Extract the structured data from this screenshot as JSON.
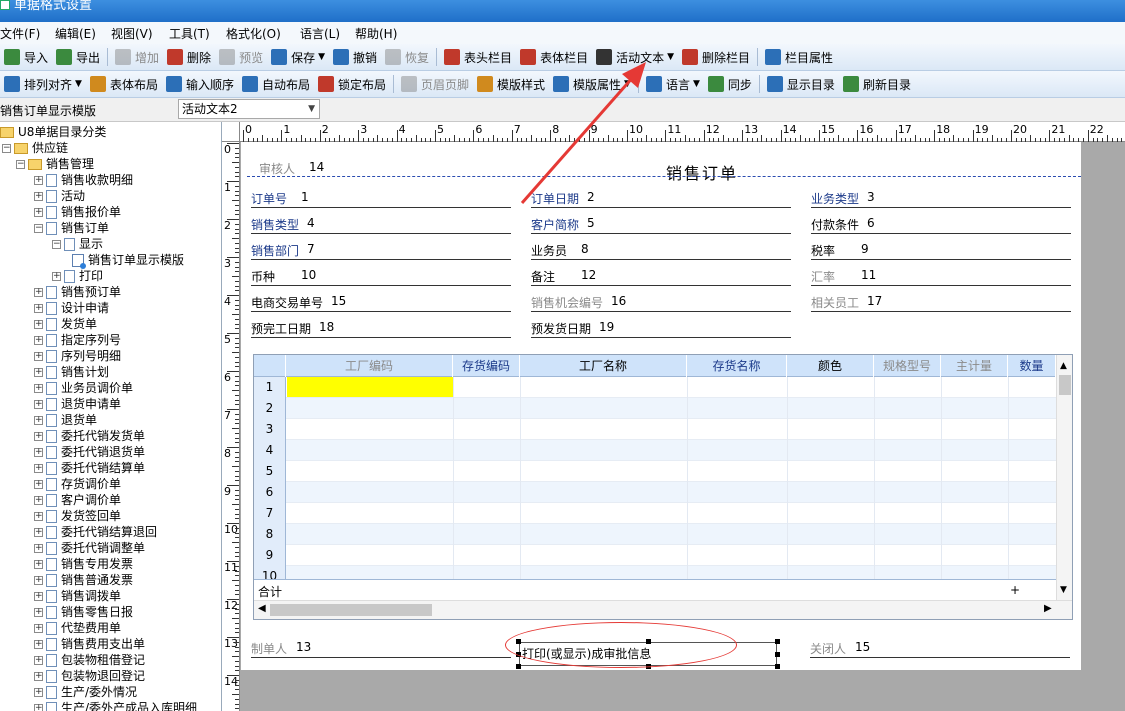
{
  "window": {
    "title": "单据格式设置"
  },
  "menu": [
    "文件(F)",
    "编辑(E)",
    "视图(V)",
    "工具(T)",
    "格式化(O)",
    "语言(L)",
    "帮助(H)"
  ],
  "toolbar1": [
    {
      "label": "导入",
      "icon": "import-icon",
      "color": "#3b8a3e",
      "enabled": true
    },
    {
      "label": "导出",
      "icon": "export-icon",
      "color": "#3b8a3e",
      "enabled": true
    },
    {
      "label": "增加",
      "icon": "add-icon",
      "color": "#7f7f7f",
      "enabled": false
    },
    {
      "label": "删除",
      "icon": "delete-icon",
      "color": "#c0392b",
      "enabled": true
    },
    {
      "label": "预览",
      "icon": "preview-icon",
      "color": "#7f7f7f",
      "enabled": false
    },
    {
      "label": "保存",
      "icon": "save-icon",
      "color": "#2c6fb7",
      "enabled": true,
      "dropdown": true
    },
    {
      "label": "撤销",
      "icon": "undo-icon",
      "color": "#2c6fb7",
      "enabled": true
    },
    {
      "label": "恢复",
      "icon": "redo-icon",
      "color": "#7f7f7f",
      "enabled": false
    },
    {
      "label": "表头栏目",
      "icon": "header-columns-icon",
      "color": "#c0392b",
      "enabled": true
    },
    {
      "label": "表体栏目",
      "icon": "body-columns-icon",
      "color": "#c0392b",
      "enabled": true
    },
    {
      "label": "活动文本",
      "icon": "active-text-icon",
      "color": "#333333",
      "enabled": true,
      "dropdown": true
    },
    {
      "label": "删除栏目",
      "icon": "delete-column-icon",
      "color": "#c0392b",
      "enabled": true
    },
    {
      "label": "栏目属性",
      "icon": "column-properties-icon",
      "color": "#2c6fb7",
      "enabled": true
    }
  ],
  "toolbar2": [
    {
      "label": "排列对齐",
      "icon": "align-icon",
      "color": "#2c6fb7",
      "enabled": true,
      "dropdown": true
    },
    {
      "label": "表体布局",
      "icon": "body-layout-icon",
      "color": "#d08a1e",
      "enabled": true
    },
    {
      "label": "输入顺序",
      "icon": "input-order-icon",
      "color": "#2c6fb7",
      "enabled": true
    },
    {
      "label": "自动布局",
      "icon": "auto-layout-icon",
      "color": "#2c6fb7",
      "enabled": true
    },
    {
      "label": "锁定布局",
      "icon": "lock-layout-icon",
      "color": "#c0392b",
      "enabled": true
    },
    {
      "label": "页眉页脚",
      "icon": "header-footer-icon",
      "color": "#7f7f7f",
      "enabled": false
    },
    {
      "label": "模版样式",
      "icon": "template-style-icon",
      "color": "#d08a1e",
      "enabled": true
    },
    {
      "label": "模版属性",
      "icon": "template-properties-icon",
      "color": "#2c6fb7",
      "enabled": true,
      "dropdown": true
    },
    {
      "label": "语言",
      "icon": "language-globe-icon",
      "color": "#2c6fb7",
      "enabled": true,
      "dropdown": true
    },
    {
      "label": "同步",
      "icon": "sync-icon",
      "color": "#3b8a3e",
      "enabled": true
    },
    {
      "label": "显示目录",
      "icon": "show-directory-icon",
      "color": "#2c6fb7",
      "enabled": true
    },
    {
      "label": "刷新目录",
      "icon": "refresh-directory-icon",
      "color": "#3b8a3e",
      "enabled": true
    }
  ],
  "template_bar": {
    "label": "销售订单显示模版",
    "selected": "活动文本2"
  },
  "tree": [
    {
      "label": "U8单据目录分类",
      "level": 0,
      "type": "folder",
      "toggle": ""
    },
    {
      "label": "供应链",
      "level": 1,
      "type": "folder",
      "toggle": "-"
    },
    {
      "label": "销售管理",
      "level": 2,
      "type": "folder",
      "toggle": "-"
    },
    {
      "label": "销售收款明细",
      "level": 3,
      "type": "doc",
      "toggle": "+"
    },
    {
      "label": "活动",
      "level": 3,
      "type": "doc",
      "toggle": "+"
    },
    {
      "label": "销售报价单",
      "level": 3,
      "type": "doc",
      "toggle": "+"
    },
    {
      "label": "销售订单",
      "level": 3,
      "type": "doc",
      "toggle": "-"
    },
    {
      "label": "显示",
      "level": 4,
      "type": "doc",
      "toggle": "-"
    },
    {
      "label": "销售订单显示模版",
      "level": 5,
      "type": "template",
      "toggle": ""
    },
    {
      "label": "打印",
      "level": 4,
      "type": "doc",
      "toggle": "+"
    },
    {
      "label": "销售预订单",
      "level": 3,
      "type": "doc",
      "toggle": "+"
    },
    {
      "label": "设计申请",
      "level": 3,
      "type": "doc",
      "toggle": "+"
    },
    {
      "label": "发货单",
      "level": 3,
      "type": "doc",
      "toggle": "+"
    },
    {
      "label": "指定序列号",
      "level": 3,
      "type": "doc",
      "toggle": "+"
    },
    {
      "label": "序列号明细",
      "level": 3,
      "type": "doc",
      "toggle": "+"
    },
    {
      "label": "销售计划",
      "level": 3,
      "type": "doc",
      "toggle": "+"
    },
    {
      "label": "业务员调价单",
      "level": 3,
      "type": "doc",
      "toggle": "+"
    },
    {
      "label": "退货申请单",
      "level": 3,
      "type": "doc",
      "toggle": "+"
    },
    {
      "label": "退货单",
      "level": 3,
      "type": "doc",
      "toggle": "+"
    },
    {
      "label": "委托代销发货单",
      "level": 3,
      "type": "doc",
      "toggle": "+"
    },
    {
      "label": "委托代销退货单",
      "level": 3,
      "type": "doc",
      "toggle": "+"
    },
    {
      "label": "委托代销结算单",
      "level": 3,
      "type": "doc",
      "toggle": "+"
    },
    {
      "label": "存货调价单",
      "level": 3,
      "type": "doc",
      "toggle": "+"
    },
    {
      "label": "客户调价单",
      "level": 3,
      "type": "doc",
      "toggle": "+"
    },
    {
      "label": "发货签回单",
      "level": 3,
      "type": "doc",
      "toggle": "+"
    },
    {
      "label": "委托代销结算退回",
      "level": 3,
      "type": "doc",
      "toggle": "+"
    },
    {
      "label": "委托代销调整单",
      "level": 3,
      "type": "doc",
      "toggle": "+"
    },
    {
      "label": "销售专用发票",
      "level": 3,
      "type": "doc",
      "toggle": "+"
    },
    {
      "label": "销售普通发票",
      "level": 3,
      "type": "doc",
      "toggle": "+"
    },
    {
      "label": "销售调拨单",
      "level": 3,
      "type": "doc",
      "toggle": "+"
    },
    {
      "label": "销售零售日报",
      "level": 3,
      "type": "doc",
      "toggle": "+"
    },
    {
      "label": "代垫费用单",
      "level": 3,
      "type": "doc",
      "toggle": "+"
    },
    {
      "label": "销售费用支出单",
      "level": 3,
      "type": "doc",
      "toggle": "+"
    },
    {
      "label": "包装物租借登记",
      "level": 3,
      "type": "doc",
      "toggle": "+"
    },
    {
      "label": "包装物退回登记",
      "level": 3,
      "type": "doc",
      "toggle": "+"
    },
    {
      "label": "生产/委外情况",
      "level": 3,
      "type": "doc",
      "toggle": "+"
    },
    {
      "label": "生产/委外产成品入库明细",
      "level": 3,
      "type": "doc",
      "toggle": "+"
    }
  ],
  "ruler": {
    "h": [
      "0",
      "1",
      "2",
      "3",
      "4",
      "5",
      "6",
      "7",
      "8",
      "9",
      "10",
      "11",
      "12",
      "13",
      "14",
      "15",
      "16",
      "17",
      "18",
      "19",
      "20",
      "21",
      "22"
    ],
    "v": [
      "0",
      "1",
      "2",
      "3",
      "4",
      "5",
      "6",
      "7",
      "8",
      "9",
      "10",
      "11",
      "12",
      "13",
      "14"
    ]
  },
  "form": {
    "title": "销售订单",
    "reviewer": {
      "label": "审核人",
      "value": "14"
    },
    "fields": [
      {
        "label": "订单号",
        "value": "1",
        "style": "blue"
      },
      {
        "label": "订单日期",
        "value": "2",
        "style": "blue"
      },
      {
        "label": "业务类型",
        "value": "3",
        "style": "blue"
      },
      {
        "label": "销售类型",
        "value": "4",
        "style": "blue"
      },
      {
        "label": "客户简称",
        "value": "5",
        "style": "blue"
      },
      {
        "label": "付款条件",
        "value": "6",
        "style": "dark"
      },
      {
        "label": "销售部门",
        "value": "7",
        "style": "blue"
      },
      {
        "label": "业务员",
        "value": "8",
        "style": "dark"
      },
      {
        "label": "税率",
        "value": "9",
        "style": "dark"
      },
      {
        "label": "币种",
        "value": "10",
        "style": "dark"
      },
      {
        "label": "备注",
        "value": "12",
        "style": "dark"
      },
      {
        "label": "汇率",
        "value": "11",
        "style": "grey"
      },
      {
        "label": "电商交易单号",
        "value": "15",
        "style": "dark"
      },
      {
        "label": "销售机会编号",
        "value": "16",
        "style": "grey"
      },
      {
        "label": "相关员工",
        "value": "17",
        "style": "grey"
      },
      {
        "label": "预完工日期",
        "value": "18",
        "style": "dark"
      },
      {
        "label": "预发货日期",
        "value": "19",
        "style": "dark"
      }
    ],
    "grid": {
      "columns": [
        {
          "label": "工厂编码",
          "style": "grey"
        },
        {
          "label": "存货编码",
          "style": "blue"
        },
        {
          "label": "工厂名称",
          "style": "dark"
        },
        {
          "label": "存货名称",
          "style": "blue"
        },
        {
          "label": "颜色",
          "style": "dark"
        },
        {
          "label": "规格型号",
          "style": "grey"
        },
        {
          "label": "主计量",
          "style": "grey"
        },
        {
          "label": "数量",
          "style": "blue"
        }
      ],
      "rows": [
        "1",
        "2",
        "3",
        "4",
        "5",
        "6",
        "7",
        "8",
        "9",
        "10"
      ],
      "sum_label": "合计",
      "sum_mark": "+"
    },
    "footer": {
      "maker": {
        "label": "制单人",
        "value": "13"
      },
      "closer": {
        "label": "关闭人",
        "value": "15"
      },
      "active_text": "打印(或显示)成审批信息"
    }
  },
  "colors": {
    "highlight": "#ffff00",
    "annotation": "#e53935",
    "label_blue": "#1c3a8a"
  }
}
